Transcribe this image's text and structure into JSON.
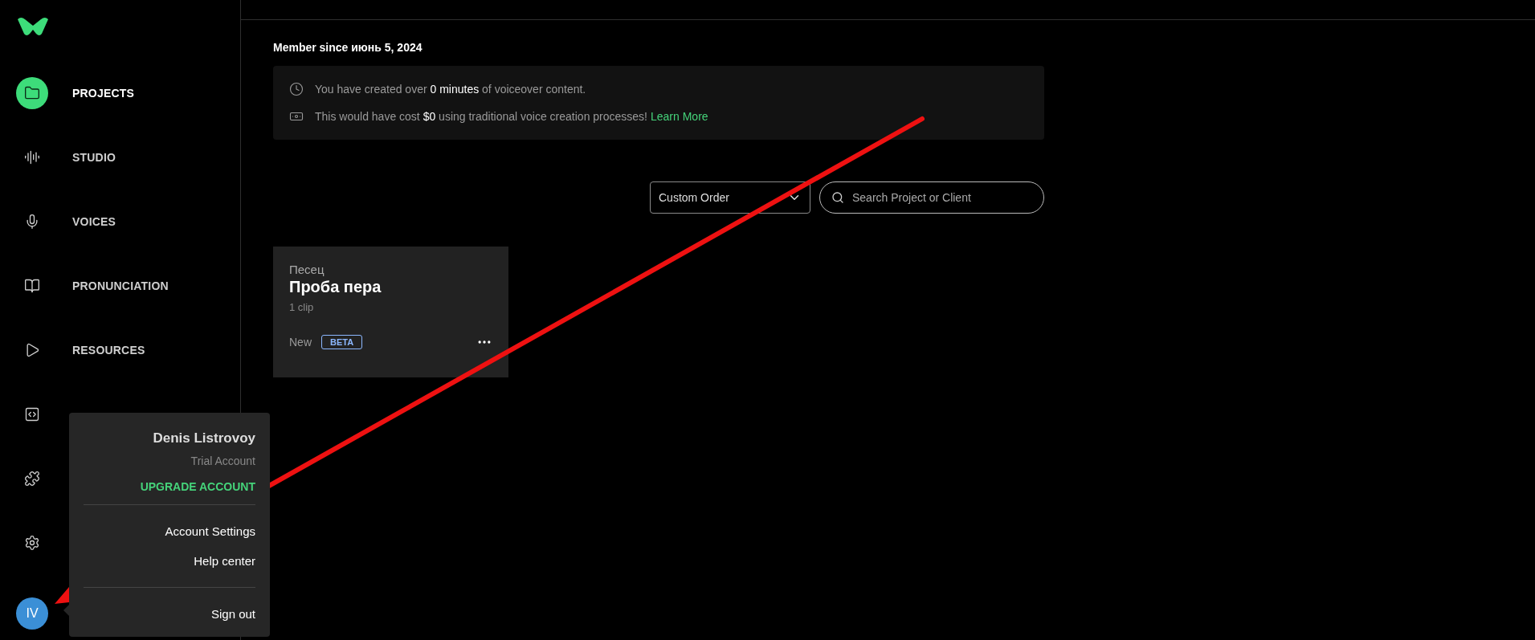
{
  "sidebar": {
    "nav_items": [
      {
        "label": "PROJECTS",
        "selected": true
      },
      {
        "label": "STUDIO",
        "selected": false
      },
      {
        "label": "VOICES",
        "selected": false
      },
      {
        "label": "PRONUNCIATION",
        "selected": false
      },
      {
        "label": "RESOURCES",
        "selected": false
      },
      {
        "selected": false
      }
    ],
    "extra_icons": [
      {
        "kind": "puzzle"
      },
      {
        "kind": "settings"
      }
    ],
    "avatar": {
      "initials": "IV"
    }
  },
  "member_since": "Member since июнь 5, 2024",
  "stats": [
    {
      "kind": "clock",
      "text": "You have created over **0 minutes** of voiceover content."
    },
    {
      "kind": "money",
      "text": "This would have cost **$0** using traditional voice creation processes!",
      "link": "Learn More"
    }
  ],
  "sort_dropdown": {
    "value": "Custom Order"
  },
  "search": {
    "placeholder": "Search Project or Client"
  },
  "projects": [
    {
      "client": "Песец",
      "title": "Проба пера",
      "clips": "1 clip",
      "status": "New",
      "badge": "BETA"
    }
  ],
  "account_menu": {
    "name": "Denis Listrovoy",
    "plan": "Trial Account",
    "upgrade": "UPGRADE ACCOUNT",
    "items": [
      "Account Settings",
      "Help center"
    ],
    "sign_out": "Sign out"
  }
}
